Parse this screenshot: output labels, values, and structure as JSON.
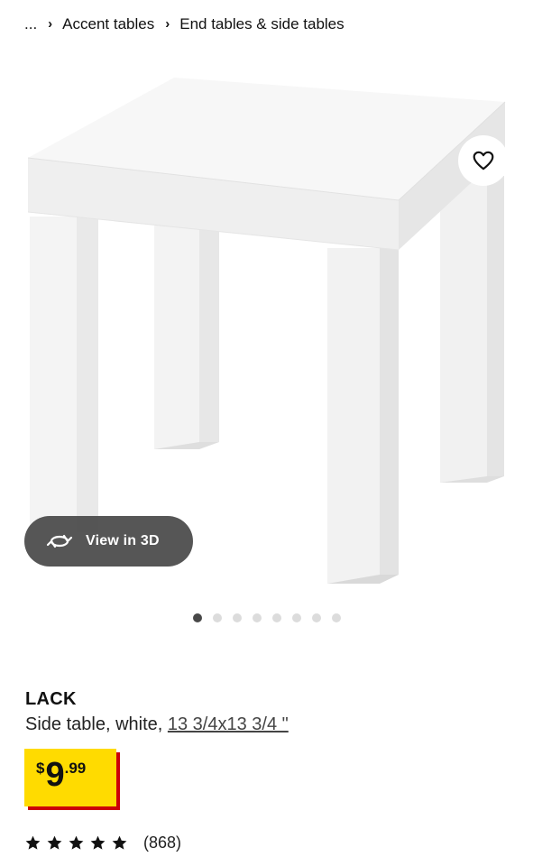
{
  "breadcrumb": {
    "ellipsis": "...",
    "items": [
      "Accent tables",
      "End tables & side tables"
    ]
  },
  "gallery": {
    "view_3d_label": "View in 3D",
    "dot_count": 8,
    "active_dot": 0
  },
  "product": {
    "name": "LACK",
    "description": "Side table, white, ",
    "measurement": "13 3/4x13 3/4 \"",
    "price": {
      "currency": "$",
      "integer": "9",
      "decimal": ".99"
    },
    "rating": {
      "stars": 5,
      "count": "(868)"
    }
  },
  "colors": {
    "price_yellow": "#ffdb00",
    "price_red": "#cc0008",
    "active_dot": "#484848",
    "inactive_dot": "#dcdcdc"
  }
}
